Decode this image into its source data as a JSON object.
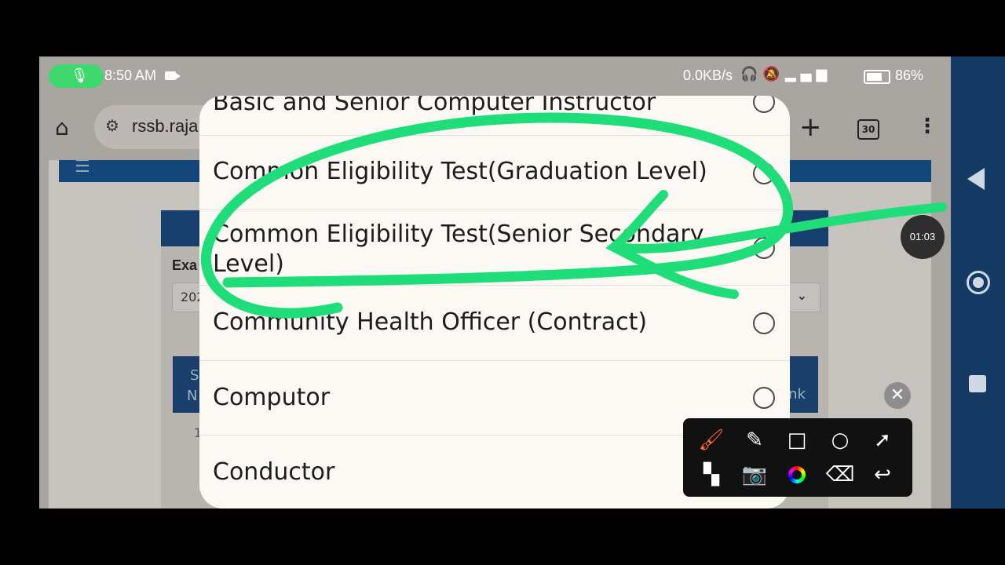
{
  "status": {
    "time": "8:50 AM",
    "speed": "0.0KB/s",
    "battery": "86%",
    "battery_level": 0.86,
    "icons": [
      "headphones-icon",
      "mute-icon",
      "volte-icon",
      "signal-icon",
      "battery-icon"
    ]
  },
  "browser": {
    "url": "rssb.raja",
    "tab_count": "30"
  },
  "page": {
    "exam_label": "Exa",
    "select_value": "202",
    "table_header_s": "S",
    "table_header_n": "N",
    "table_header_k": "nk",
    "row_no": "1"
  },
  "dialog": {
    "options": [
      {
        "label": "Basic and Senior Computer Instructor",
        "selected": false
      },
      {
        "label": "Common Eligibility Test(Graduation Level)",
        "selected": false
      },
      {
        "label": "Common Eligibility Test(Senior Secondary Level)",
        "selected": false
      },
      {
        "label": "Community Health Officer (Contract)",
        "selected": false
      },
      {
        "label": "Computor",
        "selected": false
      },
      {
        "label": "Conductor",
        "selected": false
      }
    ]
  },
  "recorder": {
    "timer": "01:03",
    "close_symbol": "✕"
  },
  "annotation_color": "#1fde7a",
  "accent_color": "#ff6b2b"
}
